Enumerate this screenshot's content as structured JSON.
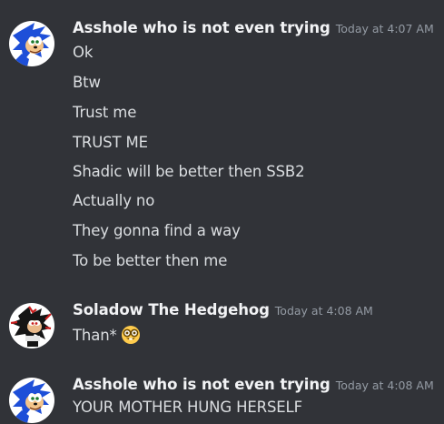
{
  "messages": [
    {
      "username": "Asshole who is not even trying",
      "timestamp": "Today at 4:07 AM",
      "avatar_icon": "sonic-avatar-icon",
      "lines": [
        "Ok",
        "Btw",
        "Trust me",
        "TRUST ME",
        "Shadic will be better then SSB2",
        "Actually no",
        "They gonna find a way",
        "To be better then me"
      ]
    },
    {
      "username": "Soladow The Hedgehog",
      "timestamp": "Today at 4:08 AM",
      "avatar_icon": "shadow-avatar-icon",
      "lines": [
        "Than*"
      ],
      "emoji": "nerd-face-emoji"
    },
    {
      "username": "Asshole who is not even trying",
      "timestamp": "Today at 4:08 AM",
      "avatar_icon": "sonic-avatar-icon",
      "lines": [
        "YOUR MOTHER HUNG HERSELF"
      ]
    }
  ],
  "colors": {
    "background": "#313338",
    "username": "#f2f3f5",
    "timestamp": "#949ba4",
    "message_text": "#dbdee1"
  }
}
